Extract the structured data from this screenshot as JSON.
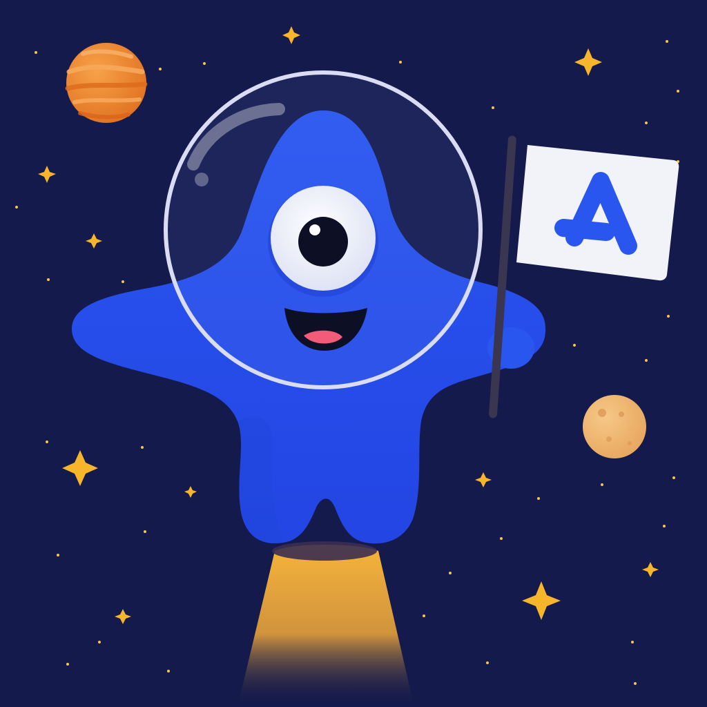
{
  "scene": {
    "subject": "one-eyed-blue-alien-astronaut",
    "icons": [
      "star-icon",
      "planet-icon",
      "moon-icon",
      "flag-icon",
      "logo-a-icon"
    ]
  },
  "colors": {
    "background": "#141a4c",
    "star": "#f7b52c",
    "alien_body": "#2a56f0",
    "alien_shadow": "#1c3bcf",
    "planet_orange": "#ef8a2f",
    "moon_tan": "#f0b56b",
    "flag": "#f2f3f8",
    "logo_blue": "#2a56f0",
    "mouth_tongue": "#f45b78",
    "jet_glow": "#f6b43a"
  }
}
